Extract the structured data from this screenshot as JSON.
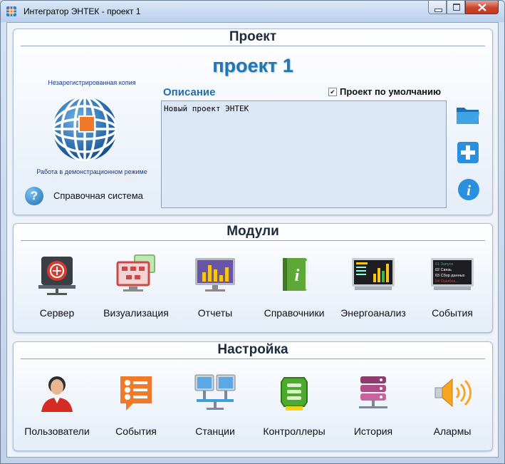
{
  "window": {
    "title": "Интегратор ЭНТЕК - проект 1",
    "controls": [
      "minimize",
      "maximize",
      "close"
    ]
  },
  "project": {
    "section_title": "Проект",
    "name": "проект 1",
    "unregistered": "Незарегистрированная копия",
    "demo_mode": "Работа в демонстрационном режиме",
    "help_label": "Справочная система",
    "description_label": "Описание",
    "default_checkbox_label": "Проект по умолчанию",
    "default_checked": true,
    "description_value": "Новый проект ЭНТЕК",
    "side_buttons": [
      "folder-icon",
      "add-icon",
      "info-icon"
    ]
  },
  "modules": {
    "section_title": "Модули",
    "items": [
      {
        "label": "Сервер",
        "icon": "server-icon"
      },
      {
        "label": "Визуализация",
        "icon": "visualization-icon"
      },
      {
        "label": "Отчеты",
        "icon": "reports-icon"
      },
      {
        "label": "Справочники",
        "icon": "reference-book-icon"
      },
      {
        "label": "Энергоанализ",
        "icon": "energy-analysis-icon"
      },
      {
        "label": "События",
        "icon": "events-monitor-icon"
      }
    ],
    "events_screen_lines": [
      "01 Запуск",
      "02 Связь",
      "03 Сбор данных",
      "04 Ошибка..."
    ]
  },
  "settings": {
    "section_title": "Настройка",
    "items": [
      {
        "label": "Пользователи",
        "icon": "user-icon"
      },
      {
        "label": "События",
        "icon": "event-list-icon"
      },
      {
        "label": "Станции",
        "icon": "stations-icon"
      },
      {
        "label": "Контроллеры",
        "icon": "controller-icon"
      },
      {
        "label": "История",
        "icon": "database-icon"
      },
      {
        "label": "Алармы",
        "icon": "alarm-speaker-icon"
      }
    ]
  },
  "colors": {
    "accent": "#1f77b4",
    "title_text": "#1c2b3d",
    "close_button": "#c9432c"
  }
}
